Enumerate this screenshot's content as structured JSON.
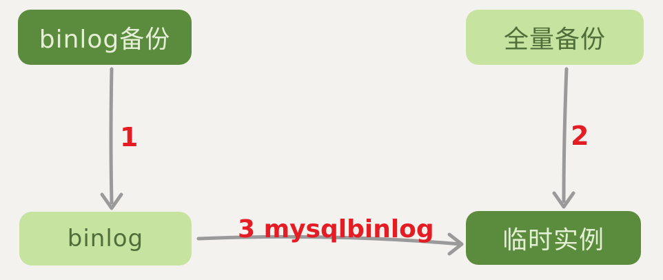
{
  "diagram": {
    "nodes": {
      "binlog_backup": "binlog备份",
      "full_backup": "全量备份",
      "binlog": "binlog",
      "temp_instance": "临时实例"
    },
    "edges": {
      "step1": "1",
      "step2": "2",
      "step3": "3 mysqlbinlog"
    },
    "colors": {
      "node_dark": "#5b8c3e",
      "node_light": "#c7e3a0",
      "arrow": "#9a9a9a",
      "label": "#e41c24"
    }
  }
}
